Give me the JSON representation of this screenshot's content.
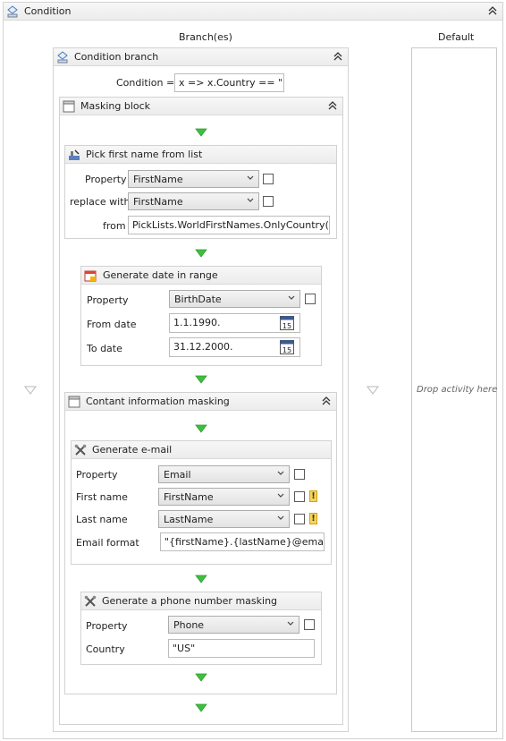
{
  "condition": {
    "title": "Condition"
  },
  "columns": {
    "branches": "Branch(es)",
    "default": "Default"
  },
  "default_drop_hint": "Drop activity here",
  "branch": {
    "title": "Condition branch",
    "condition_label": "Condition =",
    "condition_value": "x => x.Country == \"US\""
  },
  "masking_block": {
    "title": "Masking block"
  },
  "pick_first_name": {
    "title": "Pick first name from list",
    "property_label": "Property",
    "property_value": "FirstName",
    "replace_label": "replace with",
    "replace_value": "FirstName",
    "from_label": "from",
    "from_value": "PickLists.WorldFirstNames.OnlyCountry(\"US\")"
  },
  "date_range": {
    "title": "Generate date in range",
    "property_label": "Property",
    "property_value": "BirthDate",
    "from_label": "From date",
    "from_value": "1.1.1990.",
    "to_label": "To date",
    "to_value": "31.12.2000.",
    "calendar_day": "15"
  },
  "contact_masking": {
    "title": "Contant information masking"
  },
  "email": {
    "title": "Generate e-mail",
    "property_label": "Property",
    "property_value": "Email",
    "first_label": "First name",
    "first_value": "FirstName",
    "last_label": "Last name",
    "last_value": "LastName",
    "format_label": "Email format",
    "format_value": "\"{firstName}.{lastName}@email.com\"",
    "warning_glyph": "!"
  },
  "phone": {
    "title": "Generate a phone number masking",
    "property_label": "Property",
    "property_value": "Phone",
    "country_label": "Country",
    "country_value": "\"US\""
  },
  "colors": {
    "flow_arrow": "#3fbf3f",
    "drop_arrow": "#b8b8b8",
    "header_bg": "#efefef",
    "border": "#d2d2d2"
  }
}
